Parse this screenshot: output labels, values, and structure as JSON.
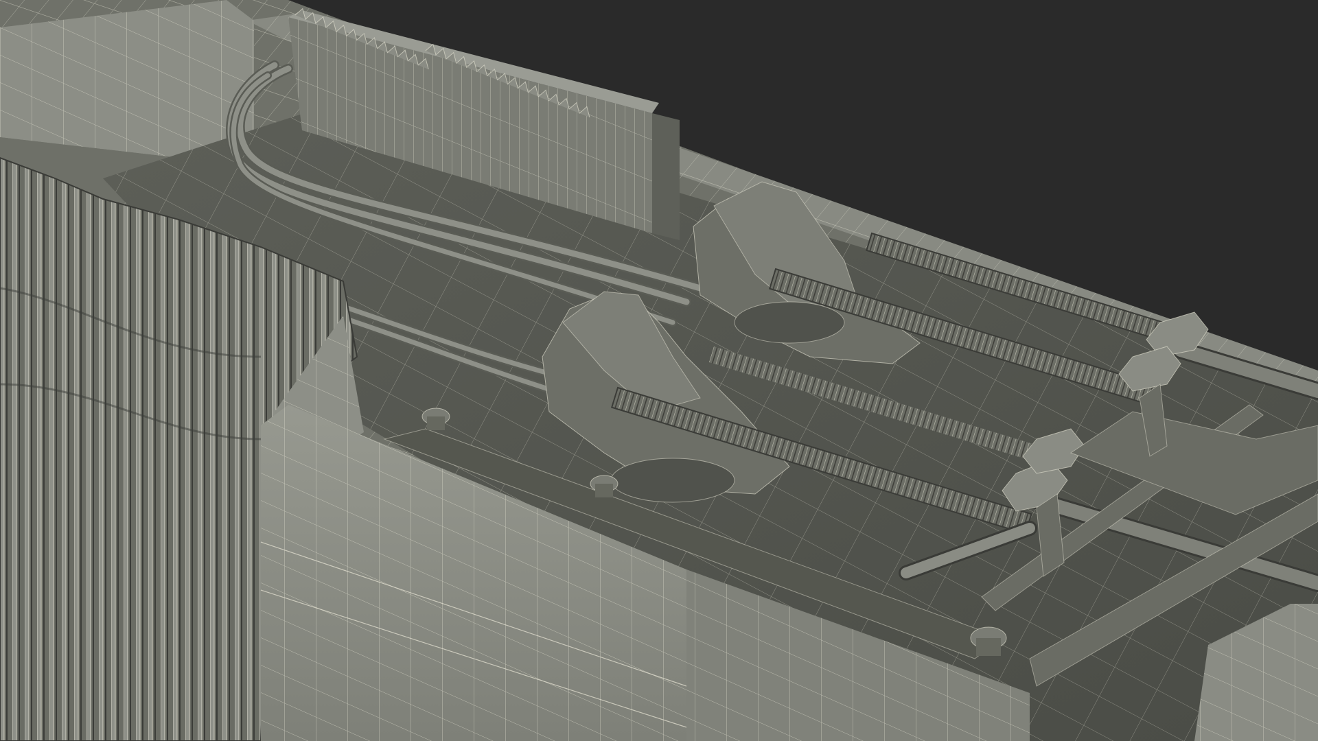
{
  "scene": {
    "subject": "wireframe-render",
    "colors": {
      "background": "#2a2a2a",
      "surface_light": "#8d8f86",
      "surface_mid": "#6f7169",
      "surface_dark": "#4a4c46",
      "surface_shadow": "#353632",
      "wire": "#e8e6d6",
      "spring": "#7a7c74",
      "spring_dark": "#3e403b"
    },
    "icons": {
      "radiator": "radiator-fins-icon",
      "spring": "spring-rod-icon",
      "bolt": "bolt-head-icon",
      "hinge": "hinge-block-icon"
    }
  }
}
